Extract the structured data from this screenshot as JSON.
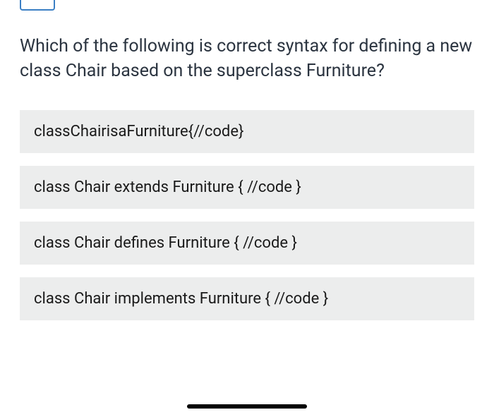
{
  "question": "Which of the following is correct syntax for defining a new class Chair based on the superclass Furniture?",
  "options": [
    "classChairisaFurniture{//code}",
    "class Chair extends Furniture { //code }",
    "class Chair defines Furniture { //code }",
    "class Chair implements Furniture { //code }"
  ]
}
